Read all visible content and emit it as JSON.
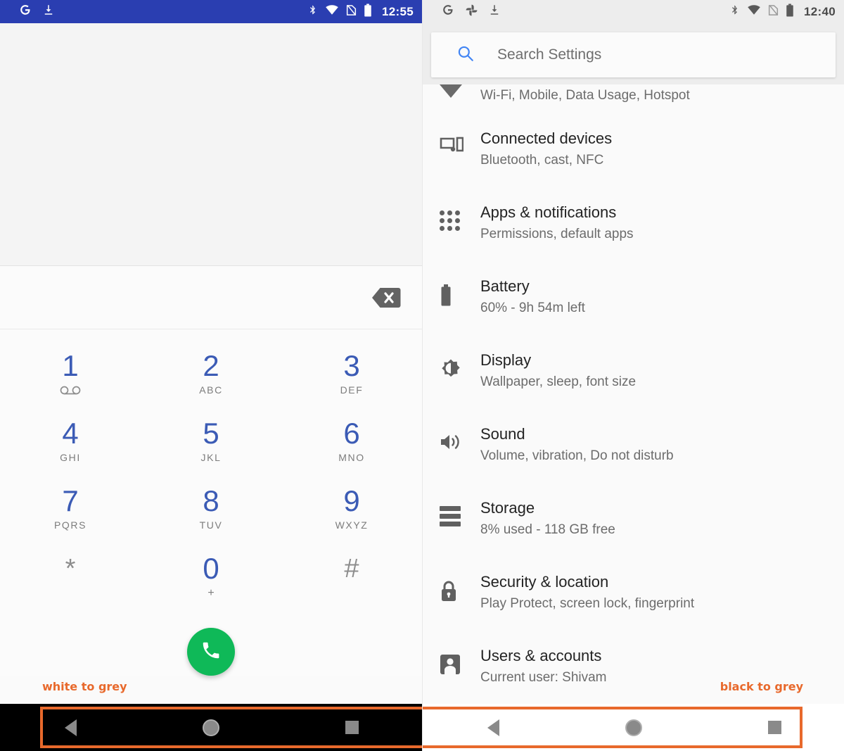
{
  "left_panel": {
    "name": "Phone dialer",
    "status_bar": {
      "background": "#2a3eb1",
      "time": "12:55",
      "left_icons": [
        "google-g-icon",
        "download-icon"
      ],
      "right_icons": [
        "bluetooth-icon",
        "wifi-icon",
        "no-sim-icon",
        "battery-icon"
      ]
    },
    "backspace_label": "backspace",
    "keypad": [
      {
        "digit": "1",
        "sub": "",
        "icon": "voicemail-icon",
        "style": "blue"
      },
      {
        "digit": "2",
        "sub": "ABC",
        "icon": "",
        "style": "blue"
      },
      {
        "digit": "3",
        "sub": "DEF",
        "icon": "",
        "style": "blue"
      },
      {
        "digit": "4",
        "sub": "GHI",
        "icon": "",
        "style": "blue"
      },
      {
        "digit": "5",
        "sub": "JKL",
        "icon": "",
        "style": "blue"
      },
      {
        "digit": "6",
        "sub": "MNO",
        "icon": "",
        "style": "blue"
      },
      {
        "digit": "7",
        "sub": "PQRS",
        "icon": "",
        "style": "blue"
      },
      {
        "digit": "8",
        "sub": "TUV",
        "icon": "",
        "style": "blue"
      },
      {
        "digit": "9",
        "sub": "WXYZ",
        "icon": "",
        "style": "blue"
      },
      {
        "digit": "*",
        "sub": "",
        "icon": "",
        "style": "grey"
      },
      {
        "digit": "0",
        "sub": "+",
        "icon": "",
        "style": "blue"
      },
      {
        "digit": "#",
        "sub": "",
        "icon": "",
        "style": "grey"
      }
    ],
    "call_button_label": "Call",
    "annotation": "white to grey",
    "nav_bar": {
      "background": "#000000",
      "buttons": [
        "back-nav-button",
        "home-nav-button",
        "recents-nav-button"
      ]
    }
  },
  "right_panel": {
    "name": "Settings",
    "status_bar": {
      "background": "#ededed",
      "time": "12:40",
      "left_icons": [
        "google-g-icon",
        "photos-pinwheel-icon",
        "download-icon"
      ],
      "right_icons": [
        "bluetooth-icon",
        "wifi-icon",
        "no-sim-icon",
        "battery-icon"
      ]
    },
    "search": {
      "placeholder": "Search Settings",
      "icon": "search-icon",
      "accent": "#4285f4"
    },
    "items": [
      {
        "title": "",
        "subtitle": "Wi-Fi, Mobile, Data Usage, Hotspot",
        "icon": "network-internet-icon",
        "clipped": true
      },
      {
        "title": "Connected devices",
        "subtitle": "Bluetooth, cast, NFC",
        "icon": "connected-devices-icon",
        "clipped": false
      },
      {
        "title": "Apps & notifications",
        "subtitle": "Permissions, default apps",
        "icon": "apps-grid-icon",
        "clipped": false
      },
      {
        "title": "Battery",
        "subtitle": "60% - 9h 54m left",
        "icon": "battery-icon",
        "clipped": false
      },
      {
        "title": "Display",
        "subtitle": "Wallpaper, sleep, font size",
        "icon": "brightness-icon",
        "clipped": false
      },
      {
        "title": "Sound",
        "subtitle": "Volume, vibration, Do not disturb",
        "icon": "volume-icon",
        "clipped": false
      },
      {
        "title": "Storage",
        "subtitle": "8% used - 118 GB free",
        "icon": "storage-icon",
        "clipped": false
      },
      {
        "title": "Security & location",
        "subtitle": "Play Protect, screen lock, fingerprint",
        "icon": "lock-icon",
        "clipped": false
      },
      {
        "title": "Users & accounts",
        "subtitle": "Current user: Shivam",
        "icon": "account-icon",
        "clipped": false
      }
    ],
    "annotation": "black to grey",
    "nav_bar": {
      "background": "#ffffff",
      "buttons": [
        "back-nav-button",
        "home-nav-button",
        "recents-nav-button"
      ]
    }
  },
  "highlight_color": "#e8692c"
}
